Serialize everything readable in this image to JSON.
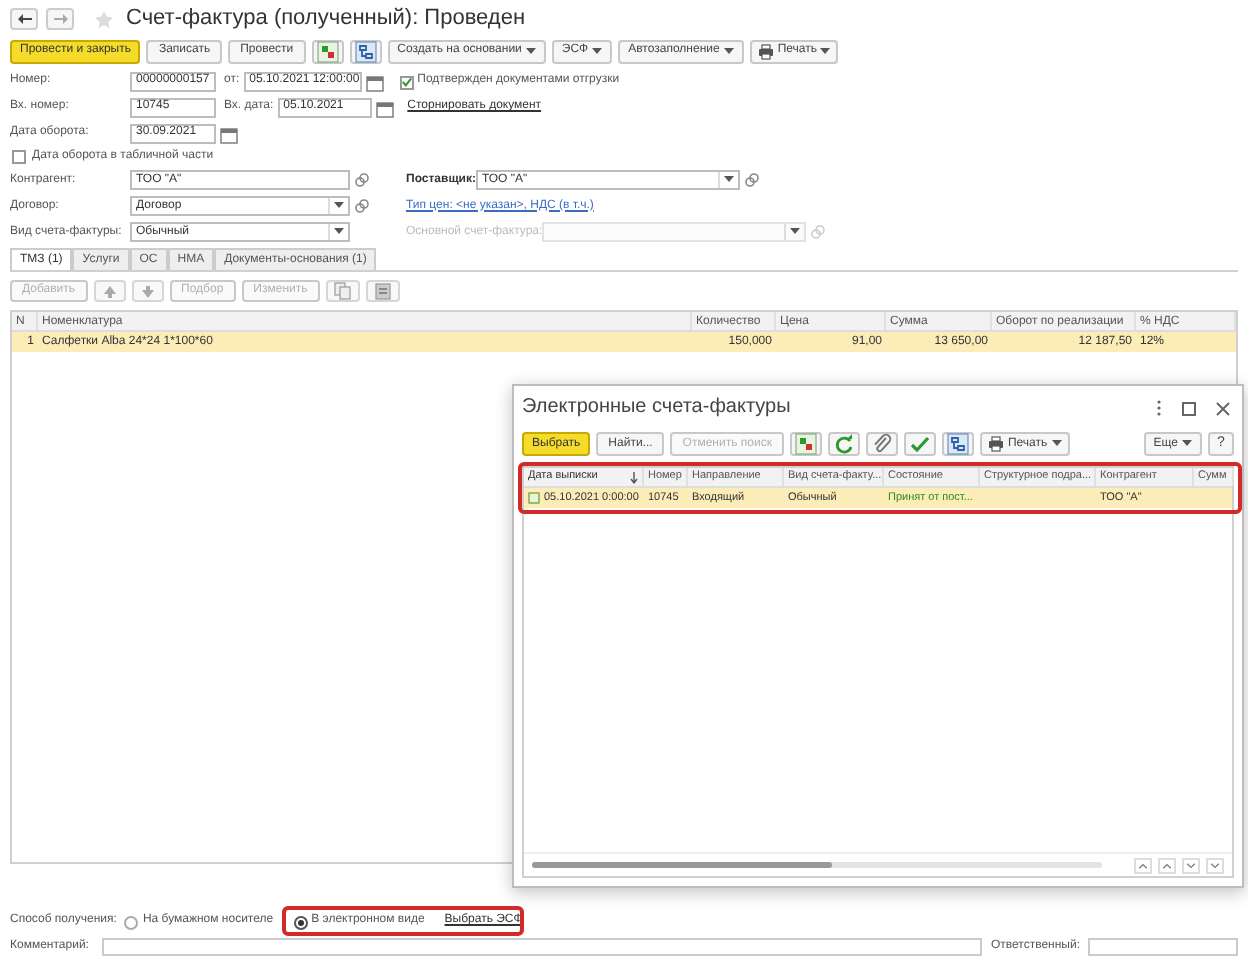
{
  "window": {
    "title": "Счет-фактура (полученный): Проведен"
  },
  "toolbar": [
    {
      "kind": "primary",
      "label": "Провести и закрыть"
    },
    {
      "kind": "plain",
      "label": "Записать"
    },
    {
      "kind": "plain",
      "label": "Провести"
    },
    {
      "kind": "dt-kt"
    },
    {
      "kind": "structure"
    },
    {
      "kind": "dropdown",
      "label": "Создать на основании"
    },
    {
      "kind": "dropdown",
      "label": "ЭСФ"
    },
    {
      "kind": "dropdown",
      "label": "Автозаполнение"
    },
    {
      "kind": "print",
      "label": "Печать"
    }
  ],
  "header": {
    "number": {
      "label": "Номер:",
      "value": "00000000157"
    },
    "date": {
      "label": "от:",
      "value": "05.10.2021 12:00:00"
    },
    "confirmed": {
      "label": "Подтвержден документами отгрузки",
      "checked": true
    },
    "in_number": {
      "label": "Вх. номер:",
      "value": "10745"
    },
    "in_date": {
      "label": "Вх. дата:",
      "value": "05.10.2021"
    },
    "storno_link": "Сторнировать документ",
    "turnover_date": {
      "label": "Дата оборота:",
      "value": "30.09.2021"
    },
    "turnover_in_table": {
      "label": "Дата оборота в табличной части",
      "checked": false
    },
    "counterparty": {
      "label": "Контрагент:",
      "value": "ТОО \"А\""
    },
    "supplier": {
      "label": "Поставщик:",
      "value": "ТОО \"А\""
    },
    "contract": {
      "label": "Договор:",
      "value": "Договор"
    },
    "price_link": "Тип цен: <не указан>, НДС (в т.ч.)",
    "invoice_kind": {
      "label": "Вид счета-фактуры:",
      "value": "Обычный"
    },
    "main_invoice": {
      "label": "Основной счет-фактура:",
      "disabled": true
    }
  },
  "tabs": [
    {
      "label": "ТМЗ (1)",
      "selected": true
    },
    {
      "label": "Услуги",
      "selected": false
    },
    {
      "label": "ОС",
      "selected": false
    },
    {
      "label": "НМА",
      "selected": false
    },
    {
      "label": "Документы-основания (1)",
      "selected": false
    }
  ],
  "table_toolbar": [
    {
      "kind": "text",
      "label": "Добавить",
      "disabled": true
    },
    {
      "kind": "up"
    },
    {
      "kind": "down"
    },
    {
      "kind": "text",
      "label": "Подбор",
      "disabled": true
    },
    {
      "kind": "text",
      "label": "Изменить",
      "disabled": true
    },
    {
      "kind": "copy"
    },
    {
      "kind": "paste"
    }
  ],
  "table": {
    "columns": [
      "N",
      "Номенклатура",
      "Количество",
      "Цена",
      "Сумма",
      "Оборот по реализации",
      "% НДС"
    ],
    "rows": [
      {
        "cells": [
          "1",
          "Салфетки Alba 24*24 1*100*60",
          "150,000",
          "91,00",
          "13 650,00",
          "12 187,50",
          "12%"
        ],
        "selected": true
      }
    ]
  },
  "dialog": {
    "title": "Электронные счета-фактуры",
    "toolbar": [
      {
        "kind": "primary",
        "label": "Выбрать",
        "disabled": false
      },
      {
        "kind": "plain",
        "label": "Найти...",
        "disabled": false
      },
      {
        "kind": "plain",
        "label": "Отменить поиск",
        "disabled": true
      },
      {
        "kind": "dt-kt"
      },
      {
        "kind": "refresh"
      },
      {
        "kind": "clip"
      },
      {
        "kind": "check"
      },
      {
        "kind": "structure"
      },
      {
        "kind": "print",
        "label": "Печать"
      }
    ],
    "more": "Еще",
    "help": "?",
    "columns": [
      {
        "label": "Дата выписки",
        "kind": "date",
        "sorted": true
      },
      {
        "label": "Номер",
        "kind": "text",
        "sorted": false
      },
      {
        "label": "Направление",
        "kind": "text",
        "sorted": false
      },
      {
        "label": "Вид счета-факту...",
        "kind": "text",
        "sorted": false
      },
      {
        "label": "Состояние",
        "kind": "status",
        "sorted": false
      },
      {
        "label": "Структурное подра...",
        "kind": "text",
        "sorted": false
      },
      {
        "label": "Контрагент",
        "kind": "text",
        "sorted": false
      },
      {
        "label": "Сумм",
        "kind": "text",
        "sorted": false
      }
    ],
    "rows": [
      {
        "cells": [
          "05.10.2021 0:00:00",
          "10745",
          "Входящий",
          "Обычный",
          "Принят от пост...",
          "",
          "ТОО \"А\"",
          ""
        ],
        "selected": true
      }
    ],
    "highlighted": true
  },
  "receipt": {
    "label": "Способ получения:",
    "options": [
      {
        "label": "На бумажном носителе",
        "selected": false
      },
      {
        "label": "В электронном виде",
        "selected": true
      }
    ],
    "link": "Выбрать ЭСФ",
    "highlighted": true
  },
  "footer": {
    "comment_label": "Комментарий:",
    "responsible_label": "Ответственный:"
  }
}
